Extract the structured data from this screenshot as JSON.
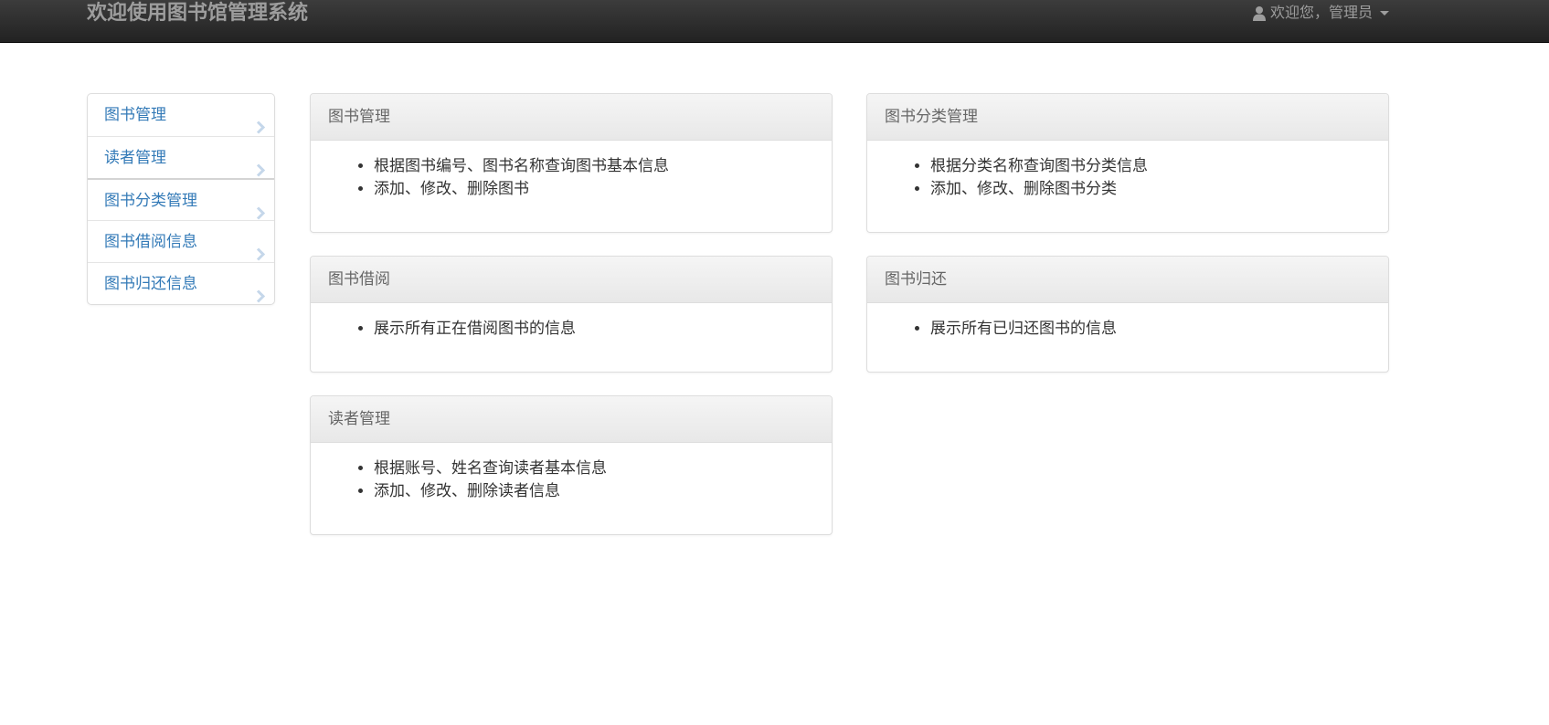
{
  "header": {
    "brand": "欢迎使用图书馆管理系统",
    "user_menu": "欢迎您，管理员",
    "user_icon": "user-icon",
    "dropdown_icon": "caret-down-icon"
  },
  "sidebar": {
    "items": [
      {
        "label": "图书管理",
        "icon": "chevron-right-icon"
      },
      {
        "label": "读者管理",
        "icon": "chevron-right-icon"
      },
      {
        "label": "图书分类管理",
        "icon": "chevron-right-icon"
      },
      {
        "label": "图书借阅信息",
        "icon": "chevron-right-icon"
      },
      {
        "label": "图书归还信息",
        "icon": "chevron-right-icon"
      }
    ]
  },
  "panels": [
    {
      "title": "图书管理",
      "items": [
        "根据图书编号、图书名称查询图书基本信息",
        "添加、修改、删除图书"
      ]
    },
    {
      "title": "图书分类管理",
      "items": [
        "根据分类名称查询图书分类信息",
        "添加、修改、删除图书分类"
      ]
    },
    {
      "title": "图书借阅",
      "items": [
        "展示所有正在借阅图书的信息"
      ]
    },
    {
      "title": "图书归还",
      "items": [
        "展示所有已归还图书的信息"
      ]
    },
    {
      "title": "读者管理",
      "items": [
        "根据账号、姓名查询读者基本信息",
        "添加、修改、删除读者信息"
      ]
    }
  ],
  "colors": {
    "navbar": "#222222",
    "link": "#337ab7",
    "chevron": "#c5d7ea",
    "muted": "#9d9d9d"
  }
}
